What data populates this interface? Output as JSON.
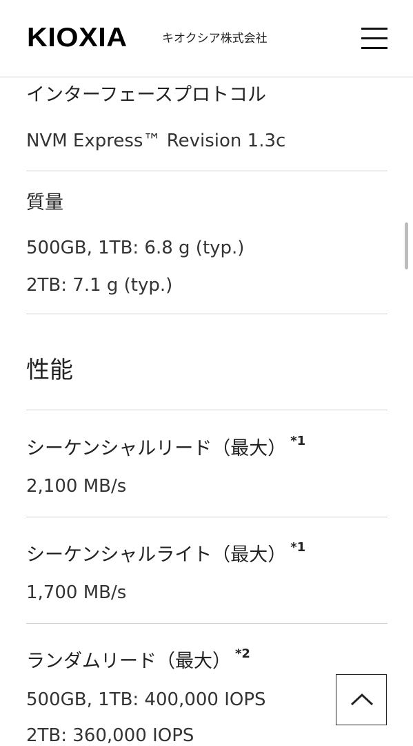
{
  "header": {
    "logo": "KIOXIA",
    "company_name": "キオクシア株式会社"
  },
  "specs": [
    {
      "label": "インターフェースプロトコル",
      "values": [
        "NVM Express™ Revision 1.3c"
      ]
    },
    {
      "label": "質量",
      "values": [
        "500GB, 1TB: 6.8 g (typ.)",
        "2TB: 7.1 g (typ.)"
      ]
    }
  ],
  "performance": {
    "title": "性能",
    "items": [
      {
        "label": "シーケンシャルリード（最大）",
        "note": "*1",
        "values": [
          "2,100 MB/s"
        ]
      },
      {
        "label": "シーケンシャルライト（最大）",
        "note": "*1",
        "values": [
          "1,700 MB/s"
        ]
      },
      {
        "label": "ランダムリード（最大）",
        "note": "*2",
        "values": [
          "500GB, 1TB: 400,000 IOPS",
          "2TB: 360,000 IOPS"
        ]
      }
    ]
  },
  "icons": {
    "menu": "hamburger-menu-icon",
    "back_to_top": "chevron-up-icon"
  }
}
